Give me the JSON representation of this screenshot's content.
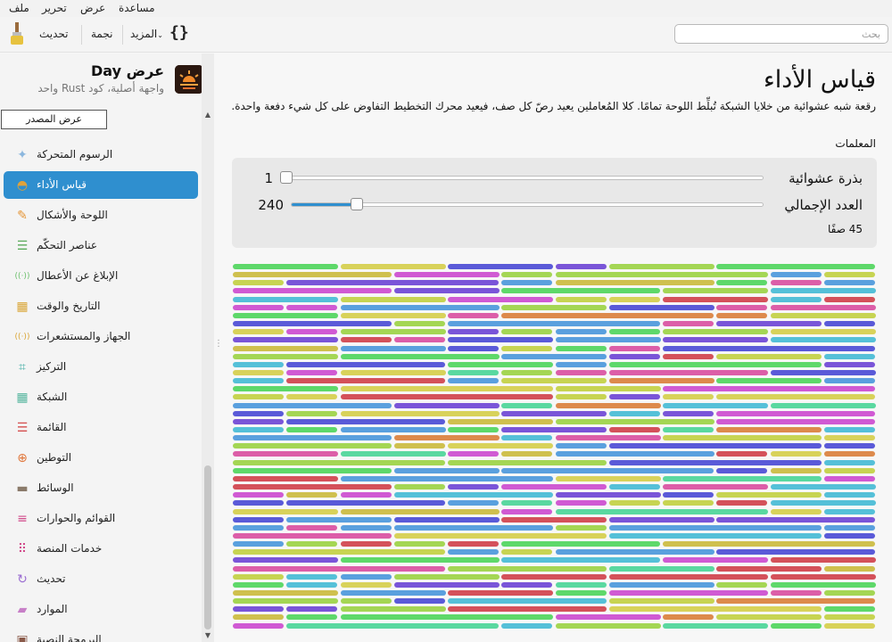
{
  "menu": [
    "ملف",
    "تحرير",
    "عرض",
    "مساعدة"
  ],
  "toolbar": {
    "update_label": "تحديث",
    "star_label": "نجمة",
    "more_label": "المزيد",
    "code_glyph": "{}",
    "search_placeholder": "بحث"
  },
  "sidebar": {
    "app_title": "عرض Day",
    "app_subtitle": "واجهة أصلية، كود Rust واحد",
    "source_button": "عرض المصدر",
    "items": [
      {
        "label": "الرسوم المتحركة",
        "icon": "sparkle-icon",
        "glyph": "✦",
        "color": "#8cb7de",
        "active": false
      },
      {
        "label": "قياس الأداء",
        "icon": "gauge-icon",
        "glyph": "◓",
        "color": "#e0a23a",
        "active": true
      },
      {
        "label": "اللوحة والأشكال",
        "icon": "brush-icon",
        "glyph": "✎",
        "color": "#e59638",
        "active": false
      },
      {
        "label": "عناصر التحكّم",
        "icon": "sliders-icon",
        "glyph": "☰",
        "color": "#5aaa5a",
        "active": false
      },
      {
        "label": "الإبلاغ عن الأعطال",
        "icon": "broadcast-icon",
        "glyph": "((·))",
        "color": "#6cbf6c",
        "active": false
      },
      {
        "label": "التاريخ والوقت",
        "icon": "calendar-icon",
        "glyph": "▦",
        "color": "#d9a536",
        "active": false
      },
      {
        "label": "الجهاز والمستشعرات",
        "icon": "sensor-icon",
        "glyph": "((·))",
        "color": "#d9a536",
        "active": false
      },
      {
        "label": "التركيز",
        "icon": "focus-icon",
        "glyph": "⌗",
        "color": "#4bb0a8",
        "active": false
      },
      {
        "label": "الشبكة",
        "icon": "grid-icon",
        "glyph": "▦",
        "color": "#55b59e",
        "active": false
      },
      {
        "label": "القائمة",
        "icon": "list-icon",
        "glyph": "☰",
        "color": "#d44e4e",
        "active": false
      },
      {
        "label": "التوطين",
        "icon": "globe-icon",
        "glyph": "⊕",
        "color": "#e0763a",
        "active": false
      },
      {
        "label": "الوسائط",
        "icon": "film-icon",
        "glyph": "▬",
        "color": "#8a7a6a",
        "active": false
      },
      {
        "label": "القوائم والحوارات",
        "icon": "menu-icon",
        "glyph": "≡",
        "color": "#d14a8a",
        "active": false
      },
      {
        "label": "خدمات المنصة",
        "icon": "dots-icon",
        "glyph": "⠿",
        "color": "#d14a8a",
        "active": false
      },
      {
        "label": "تحديث",
        "icon": "refresh-icon",
        "glyph": "↻",
        "color": "#9a6cd1",
        "active": false
      },
      {
        "label": "الموارد",
        "icon": "folder-icon",
        "glyph": "▰",
        "color": "#c77fc7",
        "active": false
      },
      {
        "label": "البرمجة النصية",
        "icon": "terminal-icon",
        "glyph": "▣",
        "color": "#8a5a4a",
        "active": false
      }
    ]
  },
  "main": {
    "title": "قياس الأداء",
    "description": "رقعة شبه عشوائية من خلايا الشبكة تُبلِّط اللوحة تمامًا. كلا المُعاملين يعيد رصّ كل صف، فيعيد محرك التخطيط التفاوض على كل شيء دفعة واحدة.",
    "params_heading": "المعلمات",
    "seed": {
      "label": "بذرة عشوائية",
      "value": "1",
      "fraction": 0.0
    },
    "total": {
      "label": "العدد الإجمالي",
      "value": "240",
      "fraction": 0.13
    },
    "rows_text": "45 صفًا",
    "grid": {
      "row_count": 45,
      "palette": [
        "#d4515a",
        "#55c0d8",
        "#cfc04e",
        "#d05ad3",
        "#5ed86a",
        "#c7d452",
        "#5aa0de",
        "#dc5ea8",
        "#dd8a4c",
        "#5a5ad8",
        "#5ad8a0",
        "#a4d654",
        "#7a55d8",
        "#d8d25a"
      ]
    }
  }
}
